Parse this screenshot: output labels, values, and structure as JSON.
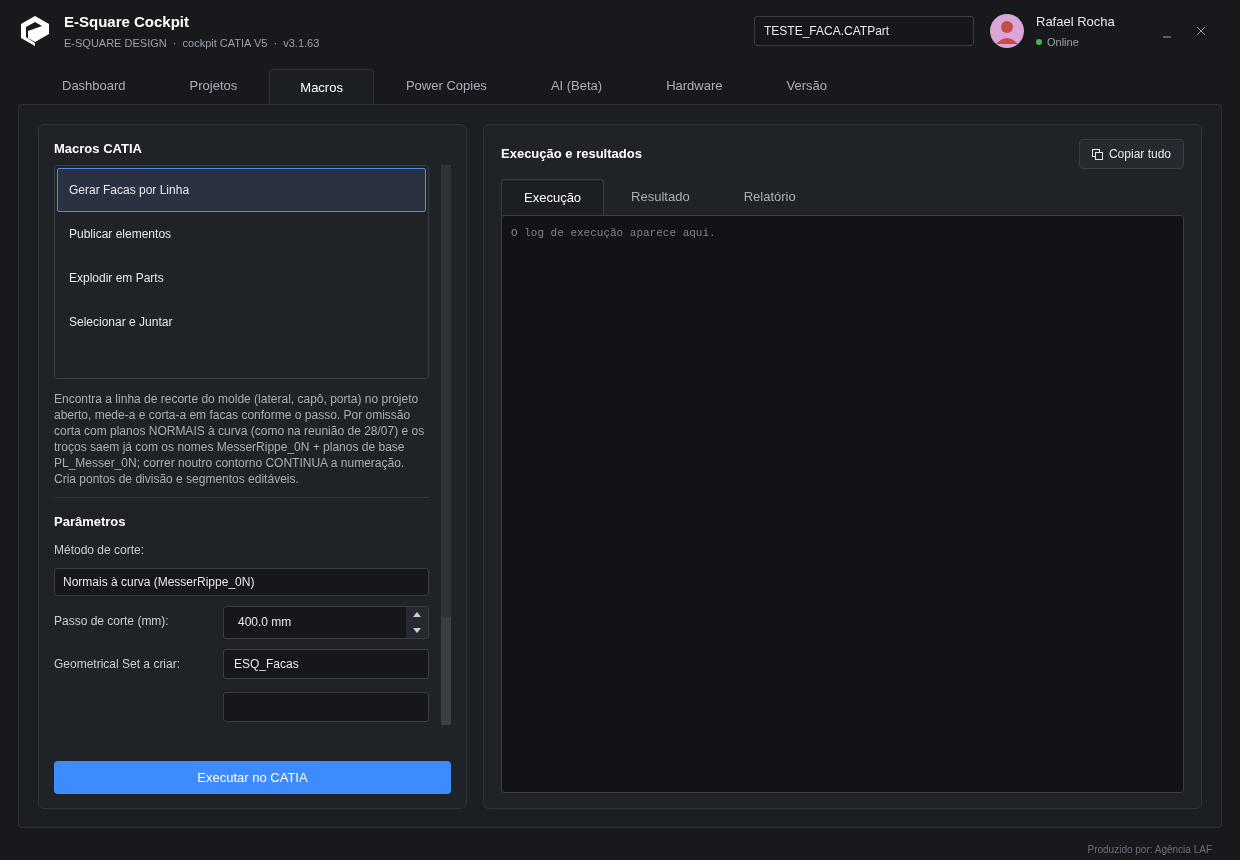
{
  "app": {
    "title": "E-Square Cockpit",
    "subtitle": "E-SQUARE DESIGN  ·  cockpit CATIA V5  ·  v3.1.63"
  },
  "file_field": {
    "value": "TESTE_FACA.CATPart"
  },
  "user": {
    "name": "Rafael Rocha",
    "status": "Online",
    "online": true
  },
  "tabs": [
    {
      "label": "Dashboard",
      "selected": false
    },
    {
      "label": "Projetos",
      "selected": false
    },
    {
      "label": "Macros",
      "selected": true
    },
    {
      "label": "Power Copies",
      "selected": false
    },
    {
      "label": "AI (Beta)",
      "selected": false
    },
    {
      "label": "Hardware",
      "selected": false
    },
    {
      "label": "Versão",
      "selected": false
    }
  ],
  "macros": {
    "title": "Macros CATIA",
    "items": [
      {
        "label": "Gerar Facas por Linha",
        "selected": true
      },
      {
        "label": "Publicar elementos",
        "selected": false
      },
      {
        "label": "Explodir em Parts",
        "selected": false
      },
      {
        "label": "Selecionar e Juntar",
        "selected": false
      }
    ],
    "description": "Encontra a linha de recorte do molde (lateral, capô, porta) no projeto aberto, mede-a e corta-a em facas conforme o passo. Por omissão corta com planos NORMAIS à curva (como na reunião de 28/07) e os troços saem já com os nomes MesserRippe_0N + planos de base PL_Messer_0N; correr noutro contorno CONTINUA a numeração. Cria pontos de divisão e segmentos editáveis.",
    "params_title": "Parâmetros",
    "method_label": "Método de corte:",
    "method_value": "Normais à curva (MesserRippe_0N)",
    "params": [
      {
        "kind": "spin",
        "label": "Passo de corte (mm):",
        "value": "400.0 mm"
      },
      {
        "kind": "text",
        "label": "Geometrical Set a criar:",
        "value": "ESQ_Facas"
      },
      {
        "kind": "hidden"
      }
    ],
    "run_button": "Executar no CATIA"
  },
  "results": {
    "title": "Execução e resultados",
    "copy_button": "Copiar tudo",
    "tabs": [
      {
        "label": "Execução",
        "selected": true
      },
      {
        "label": "Resultado",
        "selected": false
      },
      {
        "label": "Relatório",
        "selected": false
      }
    ],
    "log": {
      "placeholder": "O log de execução aparece aqui."
    }
  },
  "footer": "Produzido por: Agência LAF"
}
